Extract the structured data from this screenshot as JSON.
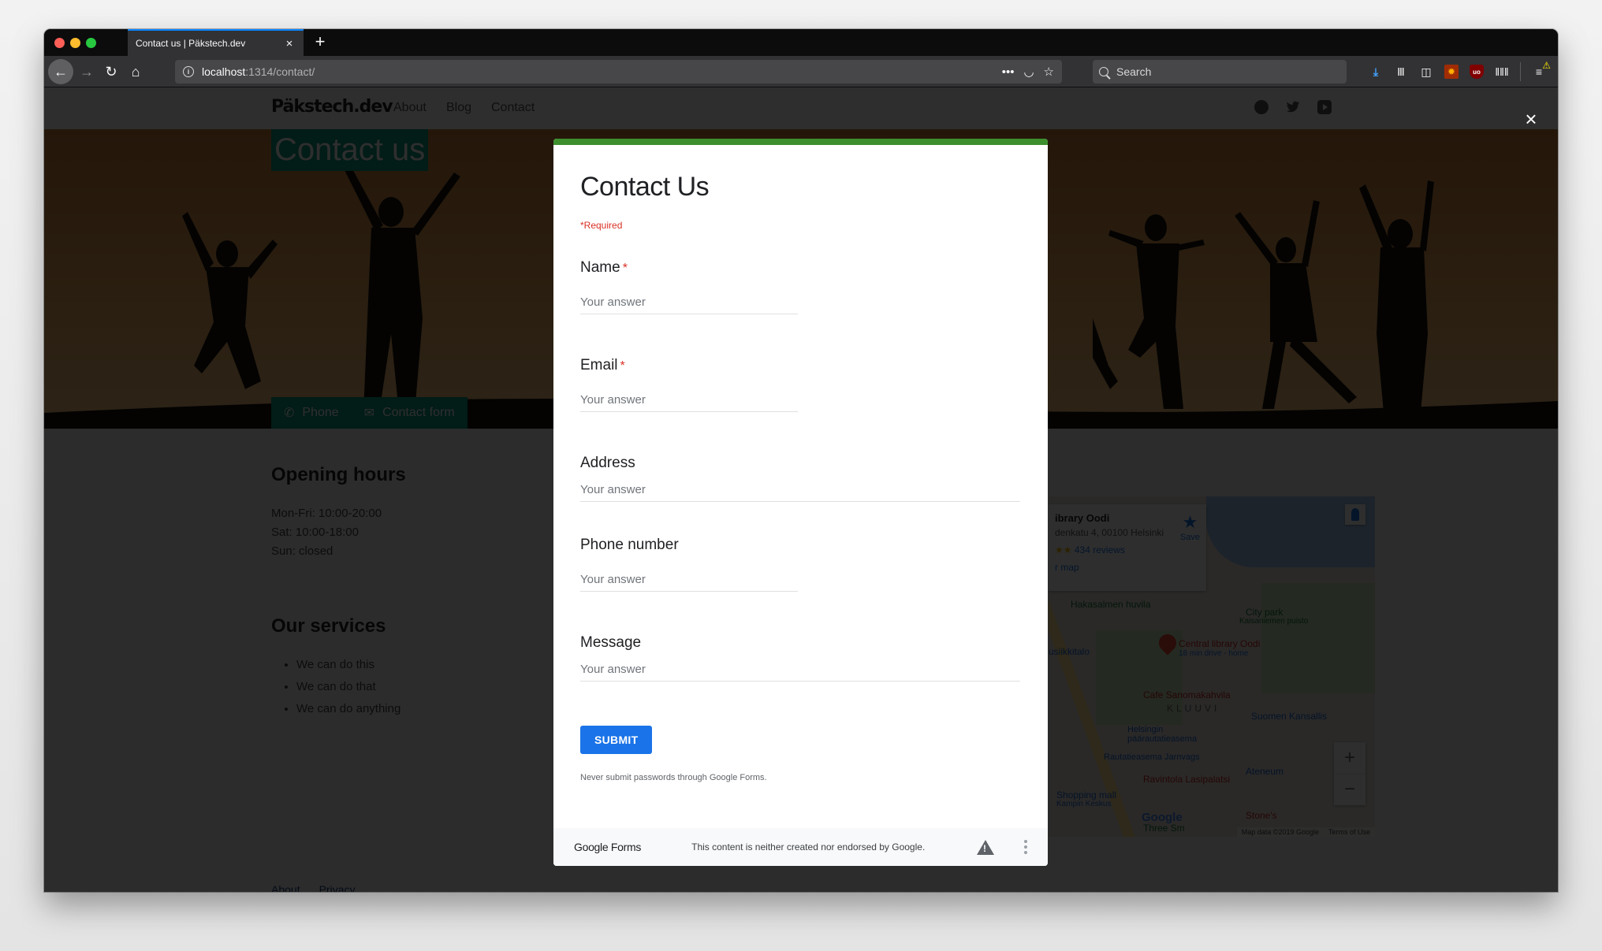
{
  "browser": {
    "tab_title": "Contact us | Päkstech.dev",
    "tab_close": "×",
    "new_tab": "+",
    "url_host": "localhost",
    "url_path": ":1314/contact/",
    "url_actions": [
      "•••",
      "pocket",
      "★"
    ],
    "search_placeholder": "Search",
    "toolbar_icons": [
      "download-icon",
      "library-icon",
      "sidebar-icon",
      "extension-icon",
      "ublock-icon",
      "extension-grid-icon",
      "menu-icon"
    ],
    "icons": {
      "back": "←",
      "forward": "→",
      "reload": "↻",
      "home": "⌂",
      "info": "i",
      "more": "•••",
      "pocket": "◡",
      "star": "☆",
      "download": "⤓",
      "library": "Ⅲ",
      "sidebar": "◫",
      "ext1": "✹",
      "ublock": "uo",
      "ext2": "ǁǁǁ",
      "menu": "≡",
      "warn": "⚠"
    }
  },
  "site": {
    "brand": "Päkstech.dev",
    "nav": [
      "About",
      "Blog",
      "Contact"
    ],
    "social": [
      "github",
      "twitter",
      "youtube"
    ],
    "hero_title": "Contact us",
    "hero_tabs": [
      {
        "icon": "✆",
        "label": "Phone"
      },
      {
        "icon": "✉",
        "label": "Contact form"
      }
    ],
    "opening_hours_heading": "Opening hours",
    "hours": [
      "Mon-Fri: 10:00-20:00",
      "Sat: 10:00-18:00",
      "Sun: closed"
    ],
    "services_heading": "Our services",
    "services": [
      "We can do this",
      "We can do that",
      "We can do anything"
    ],
    "footer_links": [
      "About",
      "Privacy"
    ],
    "map": {
      "place_name": "ibrary Oodi",
      "address": "denkatu 4, 00100 Helsinki",
      "rating_stars": "★★",
      "reviews": "434 reviews",
      "larger_map": "r map",
      "save": "Save",
      "labels": [
        "Hakasalmen huvila",
        "City park",
        "Kaisaniemen puisto",
        "usiikkitalo",
        "Central library Oodi",
        "18 min drive - home",
        "Cafe Sanomakahvila",
        "KLUUVI",
        "Suomen Kansallis",
        "Helsingin päärautatieasema",
        "Rautatieasema Jarnvags",
        "Ateneum",
        "Ravintola Lasipalatsi",
        "Shopping mall",
        "Kampin Keskus",
        "Stone's",
        "Three Sm"
      ],
      "zoom_in": "+",
      "zoom_out": "−",
      "google": "Google",
      "map_data": "Map data ©2019 Google",
      "terms": "Terms of Use"
    }
  },
  "lightbox": {
    "close": "×"
  },
  "form": {
    "title": "Contact Us",
    "required_note": "*Required",
    "accent_color": "#3d8f2e",
    "questions": [
      {
        "label": "Name",
        "required": true,
        "placeholder": "Your answer",
        "value": ""
      },
      {
        "label": "Email",
        "required": true,
        "placeholder": "Your answer",
        "value": ""
      },
      {
        "label": "Address",
        "required": false,
        "placeholder": "Your answer",
        "value": ""
      },
      {
        "label": "Phone number",
        "required": false,
        "placeholder": "Your answer",
        "value": ""
      },
      {
        "label": "Message",
        "required": false,
        "placeholder": "Your answer",
        "value": ""
      }
    ],
    "required_marker": "*",
    "submit_label": "SUBMIT",
    "never_submit_note": "Never submit passwords through Google Forms.",
    "footer_logo": "Google Forms",
    "footer_disclaimer": "This content is neither created nor endorsed by Google."
  }
}
